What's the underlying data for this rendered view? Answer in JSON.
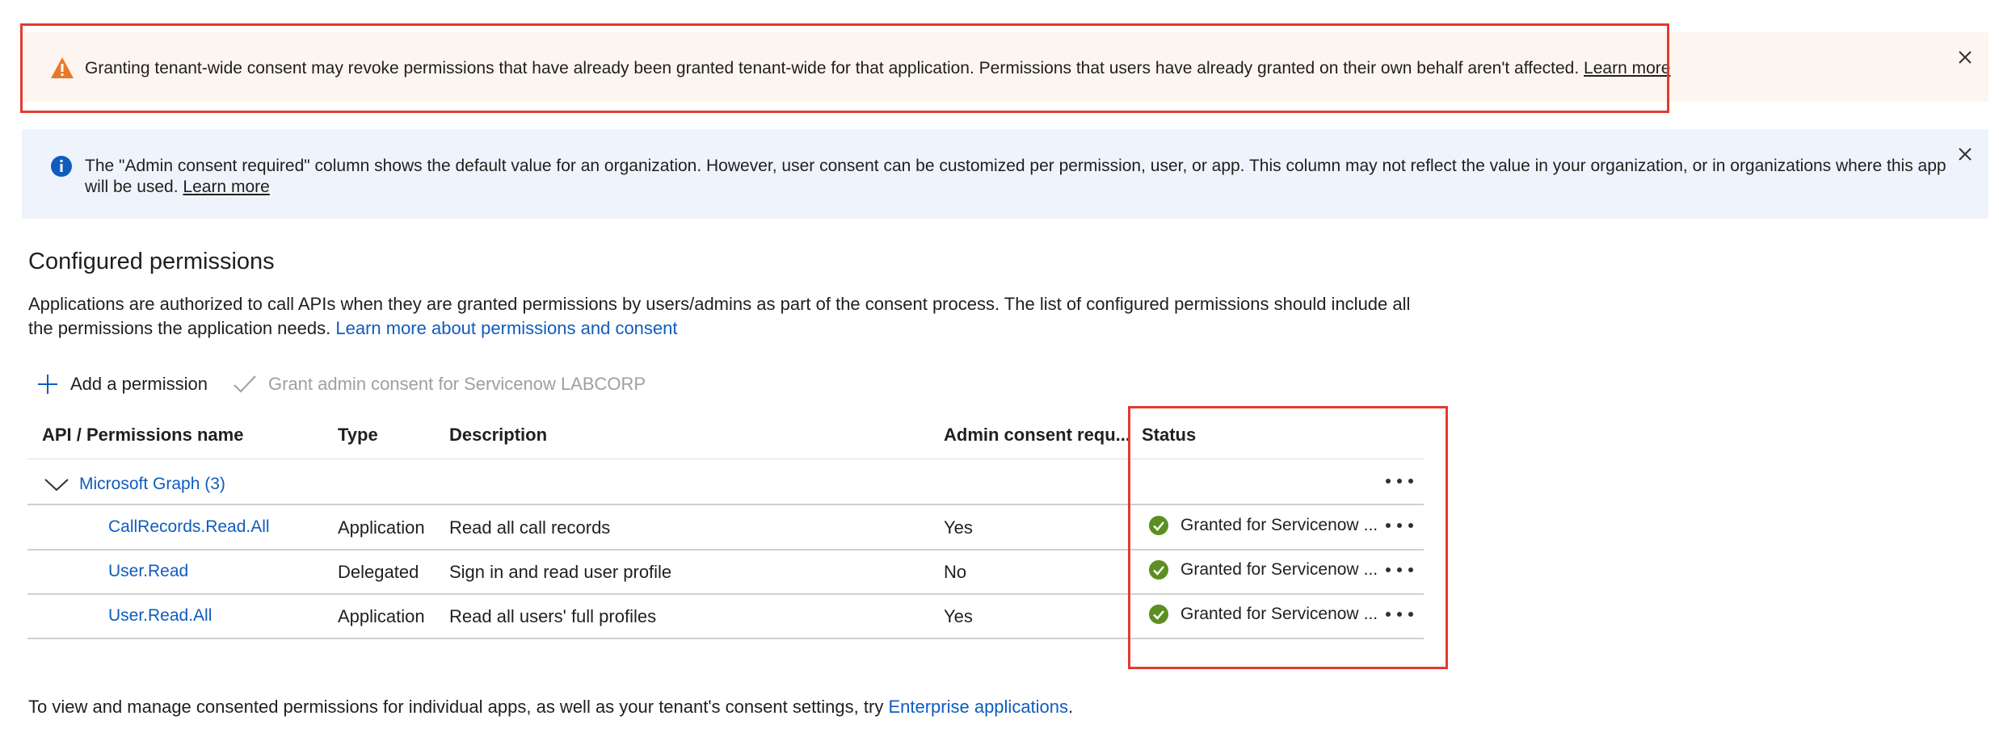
{
  "warning_banner": {
    "text": "Granting tenant-wide consent may revoke permissions that have already been granted tenant-wide for that application. Permissions that users have already granted on their own behalf aren't affected.",
    "link": "Learn more",
    "icon": "warning-triangle-icon",
    "color": "#e8792b"
  },
  "info_banner": {
    "text": "The \"Admin consent required\" column shows the default value for an organization. However, user consent can be customized per permission, user, or app. This column may not reflect the value in your organization, or in organizations where this app will be used.",
    "link": "Learn more",
    "icon": "info-circle-icon",
    "color": "#0f5cbe"
  },
  "section": {
    "title": "Configured permissions",
    "description": "Applications are authorized to call APIs when they are granted permissions by users/admins as part of the consent process. The list of configured permissions should include all the permissions the application needs.",
    "description_link": "Learn more about permissions and consent"
  },
  "toolbar": {
    "add_label": "Add a permission",
    "grant_label": "Grant admin consent for Servicenow LABCORP"
  },
  "table": {
    "headers": {
      "name": "API / Permissions name",
      "type": "Type",
      "description": "Description",
      "admin": "Admin consent requ...",
      "status": "Status"
    },
    "group": "Microsoft Graph (3)",
    "rows": [
      {
        "name": "CallRecords.Read.All",
        "type": "Application",
        "description": "Read all call records",
        "admin": "Yes",
        "status": "Granted for Servicenow",
        "status_more": "..."
      },
      {
        "name": "User.Read",
        "type": "Delegated",
        "description": "Sign in and read user profile",
        "admin": "No",
        "status": "Granted for Servicenow",
        "status_more": "..."
      },
      {
        "name": "User.Read.All",
        "type": "Application",
        "description": "Read all users' full profiles",
        "admin": "Yes",
        "status": "Granted for Servicenow",
        "status_more": "..."
      }
    ]
  },
  "footer": {
    "text": "To view and manage consented permissions for individual apps, as well as your tenant's consent settings, try",
    "link": "Enterprise applications",
    "end": "."
  }
}
